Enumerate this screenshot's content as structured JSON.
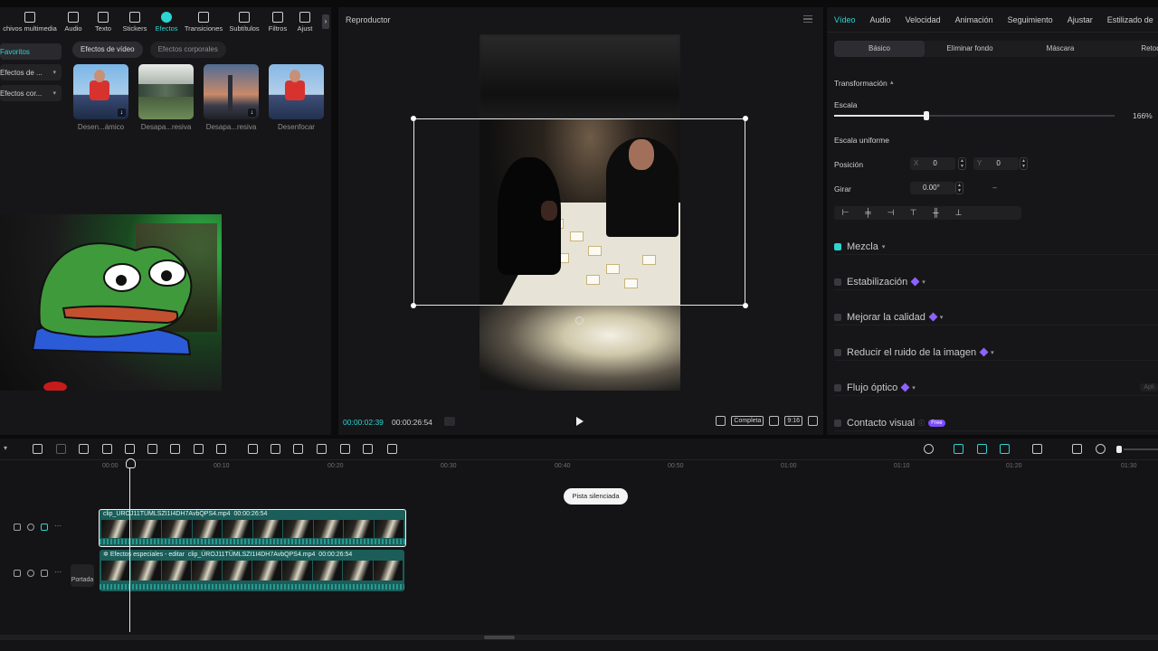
{
  "toolbar": {
    "items": [
      {
        "label": "chivos multimedia",
        "icon": "media-icon"
      },
      {
        "label": "Audio",
        "icon": "audio-icon"
      },
      {
        "label": "Texto",
        "icon": "text-icon"
      },
      {
        "label": "Stickers",
        "icon": "sticker-icon"
      },
      {
        "label": "Efectos",
        "icon": "effects-icon"
      },
      {
        "label": "Transiciones",
        "icon": "transitions-icon"
      },
      {
        "label": "Subtítulos",
        "icon": "subtitles-icon"
      },
      {
        "label": "Filtros",
        "icon": "filters-icon"
      },
      {
        "label": "Ajust",
        "icon": "adjust-icon"
      }
    ],
    "active_index": 4
  },
  "side_nav": [
    {
      "label": "Favoritos",
      "dropdown": false
    },
    {
      "label": "Efectos de ...",
      "dropdown": true
    },
    {
      "label": "Efectos cor...",
      "dropdown": true
    }
  ],
  "chips": [
    "Efectos de vídeo",
    "Efectos corporales"
  ],
  "effects": [
    {
      "name": "Desen...ámico"
    },
    {
      "name": "Desapa...resiva"
    },
    {
      "name": "Desapa...resiva"
    },
    {
      "name": "Desenfocar"
    }
  ],
  "player": {
    "title": "Reproductor",
    "current_time": "00:00:02:39",
    "total_time": "00:00:26:54",
    "full_label": "Completa",
    "ratio_label": "9:16"
  },
  "properties": {
    "tabs": [
      "Vídeo",
      "Audio",
      "Velocidad",
      "Animación",
      "Seguimiento",
      "Ajustar",
      "Estilizado de"
    ],
    "subtabs": [
      "Básico",
      "Eliminar fondo",
      "Máscara",
      "Retoq"
    ],
    "transform_label": "Transformación",
    "scale_label": "Escala",
    "scale_value": "166%",
    "scale_fraction": 0.33,
    "uniform_scale_label": "Escala uniforme",
    "position_label": "Posición",
    "pos_x_axis": "X",
    "pos_x": "0",
    "pos_y_axis": "Y",
    "pos_y": "0",
    "rotate_label": "Girar",
    "rotate_value": "0.00°",
    "options": [
      {
        "label": "Mezcla",
        "checked": true,
        "pro": false
      },
      {
        "label": "Estabilización",
        "checked": false,
        "pro": true
      },
      {
        "label": "Mejorar la calidad",
        "checked": false,
        "pro": true
      },
      {
        "label": "Reducir el ruido de la imagen",
        "checked": false,
        "pro": true
      },
      {
        "label": "Flujo óptico",
        "checked": false,
        "pro": true
      },
      {
        "label": "Contacto visual",
        "checked": false,
        "pro": false,
        "badge": "Free"
      }
    ],
    "apply_label": "Apli"
  },
  "timeline": {
    "ruler": [
      "00:00",
      "00:10",
      "00:20",
      "00:30",
      "00:40",
      "00:50",
      "01:00",
      "01:10",
      "01:20",
      "01:30"
    ],
    "silent_track_label": "Pista silenciada",
    "cover_label": "Portada",
    "clip1_name": "clip_ÜROJ11TÜMLSZI1I4DH7AvbQPS4.mp4",
    "clip1_duration": "00:00:26:54",
    "clip2_prefix": "Efectos especiales - editar",
    "clip2_name": "clip_ÜROJ11TÜMLSZI1I4DH7AvbQPS4.mp4",
    "clip2_duration": "00:00:26:54"
  },
  "colors": {
    "accent": "#2ed4d0",
    "pro_badge": "#8c63ff",
    "clip": "#1b5d58"
  }
}
